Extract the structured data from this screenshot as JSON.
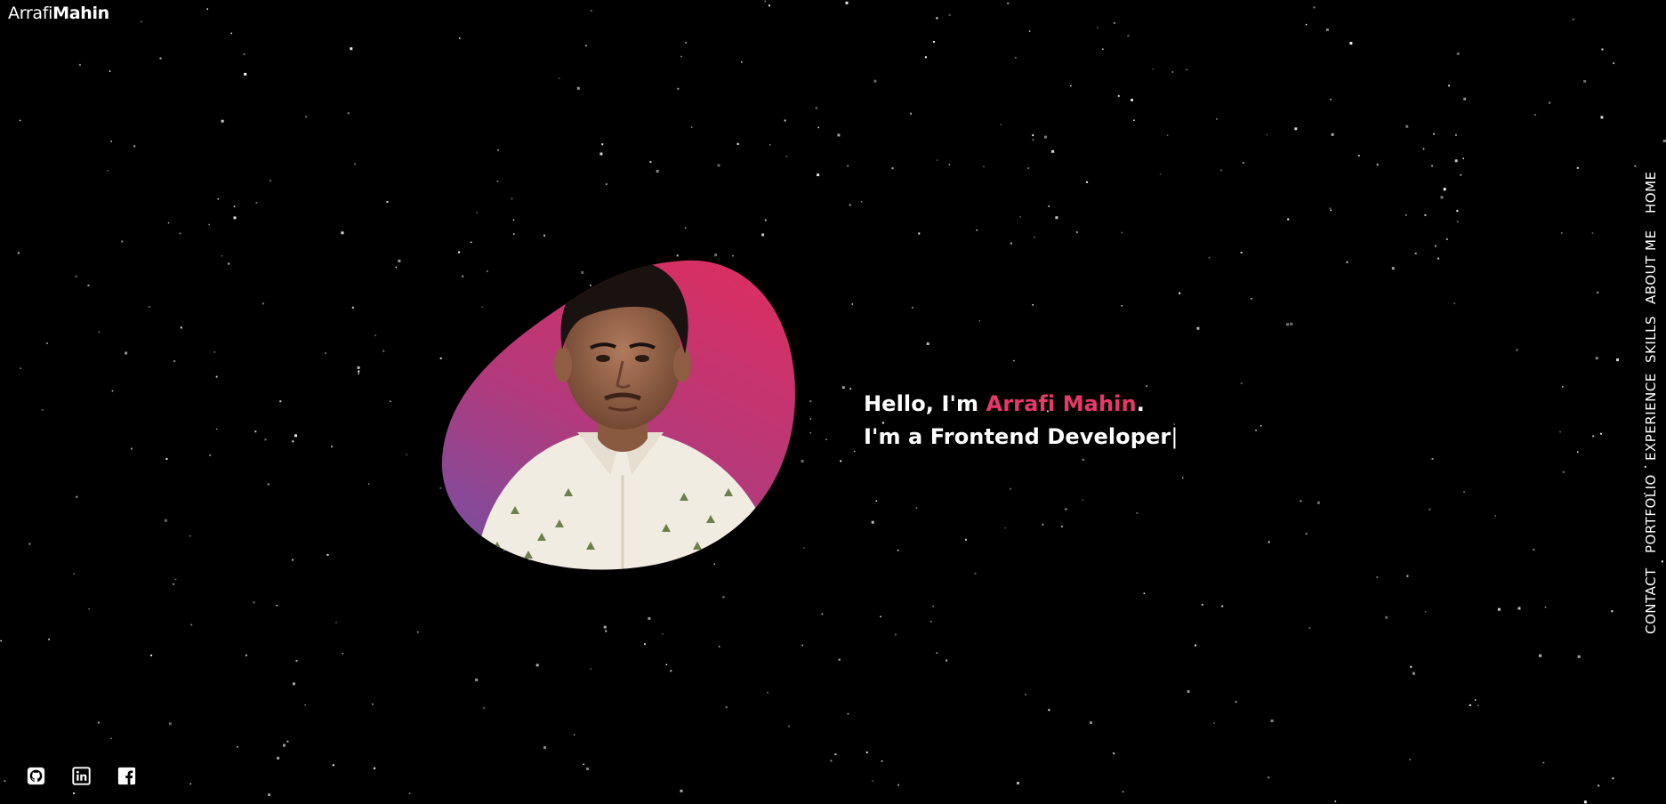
{
  "header": {
    "logo_first": "Arrafi",
    "logo_last": "Mahin"
  },
  "hero": {
    "greeting_prefix": "Hello, I'm ",
    "name": "Arrafi Mahin",
    "greeting_suffix": ".",
    "role_prefix": "I'm a ",
    "role": "Frontend Developer",
    "cursor": "|"
  },
  "nav": {
    "items": [
      "HOME",
      "ABOUT ME",
      "SKILLS",
      "EXPERIENCE",
      "PORTFOLIO",
      "CONTACT"
    ]
  },
  "socials": [
    {
      "icon": "github-icon"
    },
    {
      "icon": "linkedin-icon"
    },
    {
      "icon": "facebook-icon"
    }
  ],
  "colors": {
    "background": "#000000",
    "accent": "#e8386a",
    "blob_top": "#d82f63",
    "blob_bottom": "#7a4ea0",
    "text": "#ffffff"
  }
}
